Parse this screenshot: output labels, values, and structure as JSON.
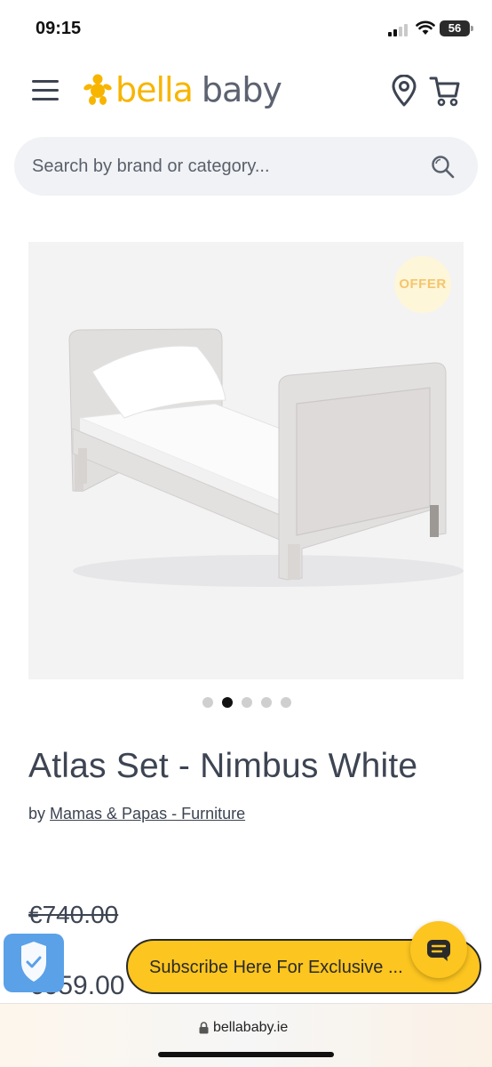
{
  "status_bar": {
    "time": "09:15",
    "battery": "56"
  },
  "header": {
    "logo_bella": "bella",
    "logo_baby": "baby"
  },
  "search": {
    "placeholder": "Search by brand or category..."
  },
  "product": {
    "badge": "OFFER",
    "title": "Atlas Set - Nimbus White",
    "by_prefix": "by",
    "brand": "Mamas & Papas - Furniture",
    "old_price": "€740.00",
    "price": "€659.00",
    "carousel": {
      "total": 5,
      "active_index": 1
    }
  },
  "widgets": {
    "subscribe_text": "Subscribe Here For Exclusive ..."
  },
  "browser": {
    "url": "bellababy.ie"
  },
  "colors": {
    "brand_yellow": "#f7b500",
    "text": "#3d4452",
    "subscribe_bg": "#fcc51f",
    "shield_bg": "#5aa1e8"
  }
}
